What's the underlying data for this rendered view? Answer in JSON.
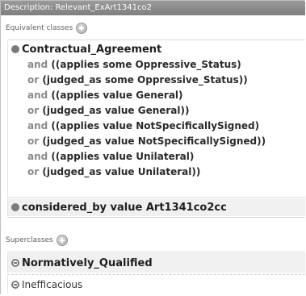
{
  "panel": {
    "title": "Description: Relevant_ExArt1341co2"
  },
  "equivalent": {
    "header": "Equivalent classes",
    "class_name": "Contractual_Agreement",
    "lines": [
      {
        "kw": "and",
        "text": "((applies some Oppressive_Status)"
      },
      {
        "kw": "or",
        "text": "(judged_as some Oppressive_Status))"
      },
      {
        "kw": "and",
        "text": "((applies value General)"
      },
      {
        "kw": "or",
        "text": "(judged_as value General))"
      },
      {
        "kw": "and",
        "text": "((applies value NotSpecificallySigned)"
      },
      {
        "kw": "or",
        "text": "(judged_as value NotSpecificallySigned))"
      },
      {
        "kw": "and",
        "text": "((applies value Unilateral)"
      },
      {
        "kw": "or",
        "text": "(judged_as value Unilateral))"
      }
    ],
    "second_class": "considered_by value Art1341co2cc"
  },
  "superclasses": {
    "header": "Superclasses",
    "items": [
      "Normatively_Qualified",
      "Inefficacious"
    ]
  },
  "icons": {
    "add": "add-circle-icon",
    "class_bullet": "class-bullet-icon",
    "superclass_bullet": "superclass-bullet-icon"
  },
  "colors": {
    "title_bar": "#8c8c8c",
    "keyword": "#8a8a8a",
    "text": "#2a2a2a",
    "shaded_row": "#f0f0f0"
  }
}
